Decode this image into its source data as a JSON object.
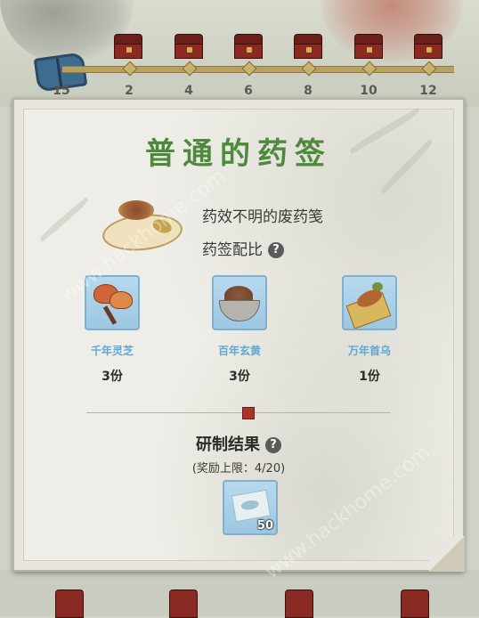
{
  "progress": {
    "current": "15",
    "milestones": [
      "2",
      "4",
      "6",
      "8",
      "10",
      "12"
    ]
  },
  "panel": {
    "title": "普通的药签",
    "item_name": "药效不明的废药笺",
    "ratio_label": "药签配比",
    "help_icon": "?",
    "ingredients": [
      {
        "name": "千年灵芝",
        "qty": "3份",
        "icon": "lingzhi-icon"
      },
      {
        "name": "百年玄黄",
        "qty": "3份",
        "icon": "xuanhuang-icon"
      },
      {
        "name": "万年首乌",
        "qty": "1份",
        "icon": "shouwu-icon"
      }
    ],
    "result_title": "研制结果",
    "reward_cap": "(奖励上限：4/20)",
    "result_count": "50"
  },
  "colors": {
    "title_green": "#4e8a3c",
    "ingredient_blue": "#5ea8d4",
    "seal_red": "#a8342b"
  },
  "watermark": "www.hackhome.com"
}
